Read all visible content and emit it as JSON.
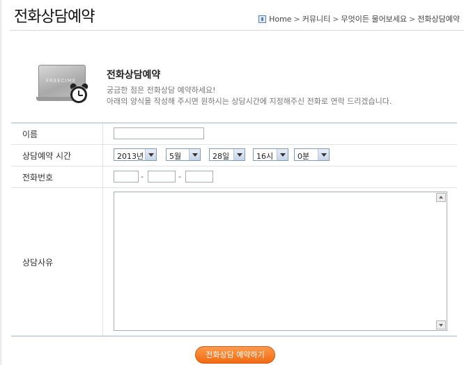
{
  "header": {
    "title": "전화상담예약",
    "breadcrumb": [
      "Home",
      "커뮤니티",
      "무엇이든 물어보세요",
      "전화상담예약"
    ],
    "separator": ">"
  },
  "intro": {
    "title": "전화상담예약",
    "line1": "궁금한 점은 전화상담 예약하세요!",
    "line2": "아래의 양식을 작성해 주시면 원하시는 상담시간에 지정해주신 전화로 연락 드리겠습니다.",
    "laptop_brand": "FREECIME"
  },
  "form": {
    "name_label": "이름",
    "name_value": "",
    "time_label": "상담예약 시간",
    "year": "2013년",
    "month": "5월",
    "day": "28일",
    "hour": "16시",
    "minute": "0분",
    "phone_label": "전화번호",
    "phone_dash": "-",
    "phone1": "",
    "phone2": "",
    "phone3": "",
    "reason_label": "상담사유",
    "reason_value": ""
  },
  "submit_label": "전화상담 예약하기",
  "colors": {
    "accent": "#f06a12",
    "table_border": "#9fb7cf"
  }
}
